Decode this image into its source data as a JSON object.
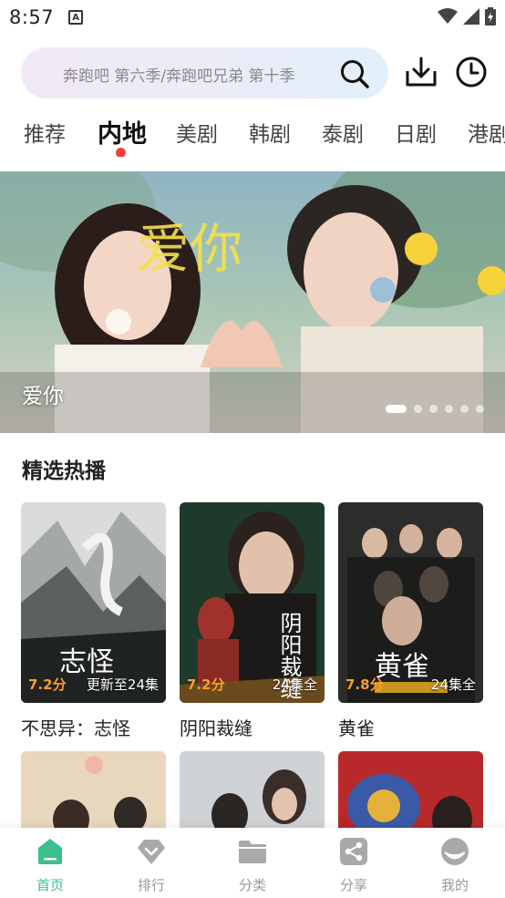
{
  "status_bar": {
    "time": "8:57",
    "notification_letter": "A"
  },
  "search": {
    "placeholder": "奔跑吧 第六季/奔跑吧兄弟 第十季"
  },
  "tabs": [
    {
      "label": "推荐",
      "active": false
    },
    {
      "label": "内地",
      "active": true
    },
    {
      "label": "美剧",
      "active": false
    },
    {
      "label": "韩剧",
      "active": false
    },
    {
      "label": "泰剧",
      "active": false
    },
    {
      "label": "日剧",
      "active": false
    },
    {
      "label": "港剧",
      "active": false
    }
  ],
  "banner": {
    "title": "爱你",
    "overlay_text": "爱你",
    "slide_count": 6,
    "active_slide": 1
  },
  "section": {
    "title": "精选热播"
  },
  "shows": [
    {
      "title": "不思异：志怪",
      "rating": "7.2分",
      "episodes": "更新至24集",
      "poster_text": "志怪"
    },
    {
      "title": "阴阳裁缝",
      "rating": "7.2分",
      "episodes": "24集全",
      "poster_text": "阴阳裁缝"
    },
    {
      "title": "黄雀",
      "rating": "7.8分",
      "episodes": "24集全",
      "poster_text": "黄雀"
    }
  ],
  "bottom_nav": [
    {
      "label": "首页",
      "icon": "home-icon",
      "active": true
    },
    {
      "label": "排行",
      "icon": "rank-icon",
      "active": false
    },
    {
      "label": "分类",
      "icon": "folder-icon",
      "active": false
    },
    {
      "label": "分享",
      "icon": "share-icon",
      "active": false
    },
    {
      "label": "我的",
      "icon": "profile-icon",
      "active": false
    }
  ],
  "colors": {
    "accent_green": "#3dbf8c",
    "rating_orange": "#ff9d2a",
    "active_dot_red": "#f44336"
  }
}
